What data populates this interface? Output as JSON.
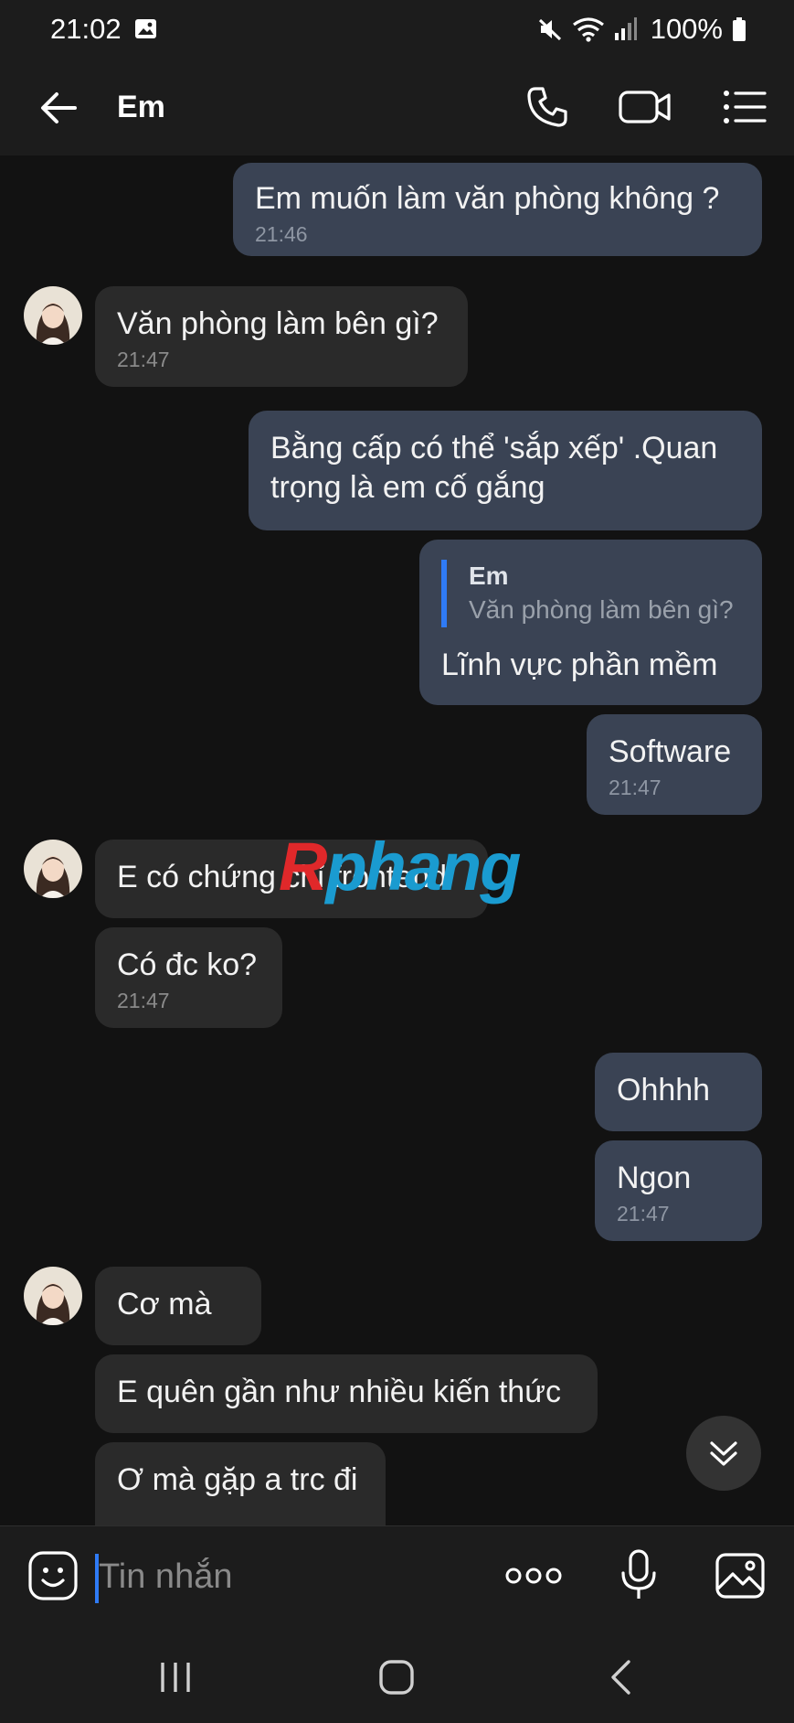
{
  "status_bar": {
    "time": "21:02",
    "battery": "100%"
  },
  "header": {
    "title": "Em"
  },
  "messages": [
    {
      "side": "out",
      "text": "Em muốn làm văn phòng không ?",
      "time": "21:46"
    },
    {
      "side": "in",
      "text": "Văn phòng làm bên gì?",
      "time": "21:47"
    },
    {
      "side": "out",
      "text": "Bằng cấp có thể 'sắp xếp' .Quan trọng là em cố gắng"
    },
    {
      "side": "out",
      "reply_to_name": "Em",
      "reply_to_text": "Văn phòng làm bên gì?",
      "text": "Lĩnh vực phần mềm"
    },
    {
      "side": "out",
      "text": "Software",
      "time": "21:47"
    },
    {
      "side": "in",
      "text": "E có chứng chỉ frontend"
    },
    {
      "side": "in",
      "text": "Có đc ko?",
      "time": "21:47"
    },
    {
      "side": "out",
      "text": "Ohhhh"
    },
    {
      "side": "out",
      "text": "Ngon",
      "time": "21:47"
    },
    {
      "side": "in",
      "text": "Cơ mà"
    },
    {
      "side": "in",
      "text": "E quên gần như nhiều kiến thức"
    },
    {
      "side": "in",
      "text": "Ơ mà gặp a trc đi"
    }
  ],
  "watermark": {
    "part1": "R",
    "part2": "phang"
  },
  "composer": {
    "placeholder": "Tin nhắn"
  },
  "colors": {
    "outgoing_bubble": "#3a4354",
    "incoming_bubble": "#2a2a2a",
    "accent": "#2f7bf6",
    "background": "#121212"
  }
}
